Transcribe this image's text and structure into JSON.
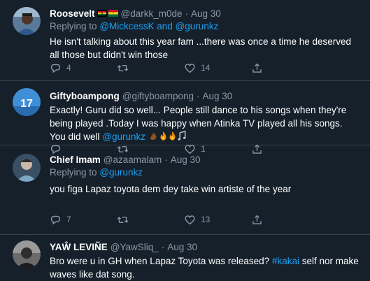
{
  "tweets": [
    {
      "display_name": "Roosevelt",
      "handle": "@darkk_m0de",
      "separator": "·",
      "date": "Aug 30",
      "replying_prefix": "Replying to",
      "reply_mention_1": "@MickcessK",
      "reply_and": "and",
      "reply_mention_2": "@gurunkz",
      "text": "He isn't talking about this year fam ...there was once a time he deserved all those but didn't win those",
      "reply_count": "4",
      "retweet_count": "",
      "like_count": "14"
    },
    {
      "display_name": "Giftyboampong",
      "handle": "@giftyboampong",
      "separator": "·",
      "date": "Aug 30",
      "text": "Exactly! Guru did so well... People still dance to his songs when they're being played .Today I was happy when Atinka TV played all his songs. You did well",
      "mention": "@gurunkz",
      "reply_count": "",
      "retweet_count": "",
      "like_count": "1"
    },
    {
      "display_name": "Chief Imam",
      "handle": "@azaamalam",
      "separator": "·",
      "date": "Aug 30",
      "replying_prefix": "Replying to",
      "reply_mention_1": "@gurunkz",
      "text": "you figa Lapaz toyota dem dey take win artiste of the year",
      "reply_count": "7",
      "retweet_count": "",
      "like_count": "13"
    },
    {
      "display_name": "YAŴ LEVIÑE",
      "handle": "@YawSliq_",
      "separator": "·",
      "date": "Aug 30",
      "text_before": "Bro were u in GH when Lapaz Toyota was released?",
      "hashtag": "#kakai",
      "text_after": "self nor make waves like dat song."
    }
  ],
  "icons": {
    "reply": "reply-icon",
    "retweet": "retweet-icon",
    "like": "heart-icon",
    "share": "share-icon"
  },
  "colors": {
    "background": "#15202b",
    "divider": "#38444d",
    "secondary_text": "#8899a6",
    "link": "#1da1f2"
  }
}
